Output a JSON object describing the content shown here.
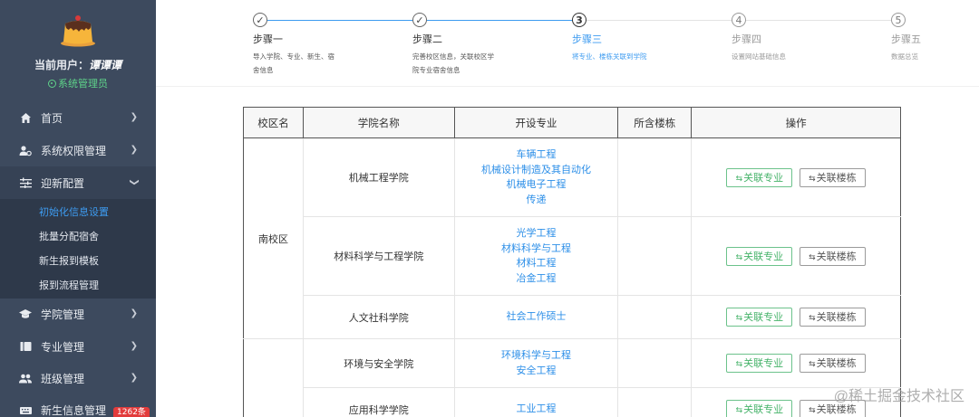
{
  "sidebar": {
    "current_user_label": "当前用户：",
    "current_user_name": "谭谭谭",
    "role": "系统管理员",
    "menu": [
      {
        "label": "首页",
        "icon": "home-icon"
      },
      {
        "label": "系统权限管理",
        "icon": "user-settings-icon"
      },
      {
        "label": "迎新配置",
        "icon": "sliders-icon"
      },
      {
        "label": "学院管理",
        "icon": "graduation-cap-icon"
      },
      {
        "label": "专业管理",
        "icon": "id-card-icon"
      },
      {
        "label": "班级管理",
        "icon": "group-icon"
      },
      {
        "label": "新生信息管理",
        "icon": "keyboard-icon",
        "badge": "1262条"
      }
    ],
    "submenu": [
      {
        "label": "初始化信息设置",
        "active": true
      },
      {
        "label": "批量分配宿舍"
      },
      {
        "label": "新生报到模板"
      },
      {
        "label": "报到流程管理"
      }
    ]
  },
  "steps": [
    {
      "num": "1",
      "title": "步骤一",
      "desc": "导入学院、专业、新生、宿舍信息",
      "status": "done"
    },
    {
      "num": "2",
      "title": "步骤二",
      "desc": "完善校区信息，关联校区学院专业宿舍信息",
      "status": "done"
    },
    {
      "num": "3",
      "title": "步骤三",
      "desc": "将专业、楼栋关联到学院",
      "status": "current"
    },
    {
      "num": "4",
      "title": "步骤四",
      "desc": "设置网站基础信息",
      "status": "wait"
    },
    {
      "num": "5",
      "title": "步骤五",
      "desc": "数据总览",
      "status": "wait"
    }
  ],
  "table": {
    "headers": [
      "校区名",
      "学院名称",
      "开设专业",
      "所含楼栋",
      "操作"
    ],
    "btn_major": "关联专业",
    "btn_building": "关联楼栋",
    "campus1": "南校区",
    "rows": [
      {
        "college": "机械工程学院",
        "majors": [
          "车辆工程",
          "机械设计制造及其自动化",
          "机械电子工程",
          "传递"
        ]
      },
      {
        "college": "材料科学与工程学院",
        "majors": [
          "光学工程",
          "材料科学与工程",
          "材料工程",
          "冶金工程"
        ]
      },
      {
        "college": "人文社科学院",
        "majors": [
          "社会工作硕士"
        ]
      },
      {
        "college": "环境与安全学院",
        "majors": [
          "环境科学与工程",
          "安全工程"
        ]
      },
      {
        "college": "应用科学学院",
        "majors": [
          "工业工程"
        ]
      }
    ]
  },
  "watermark": "@稀土掘金技术社区"
}
